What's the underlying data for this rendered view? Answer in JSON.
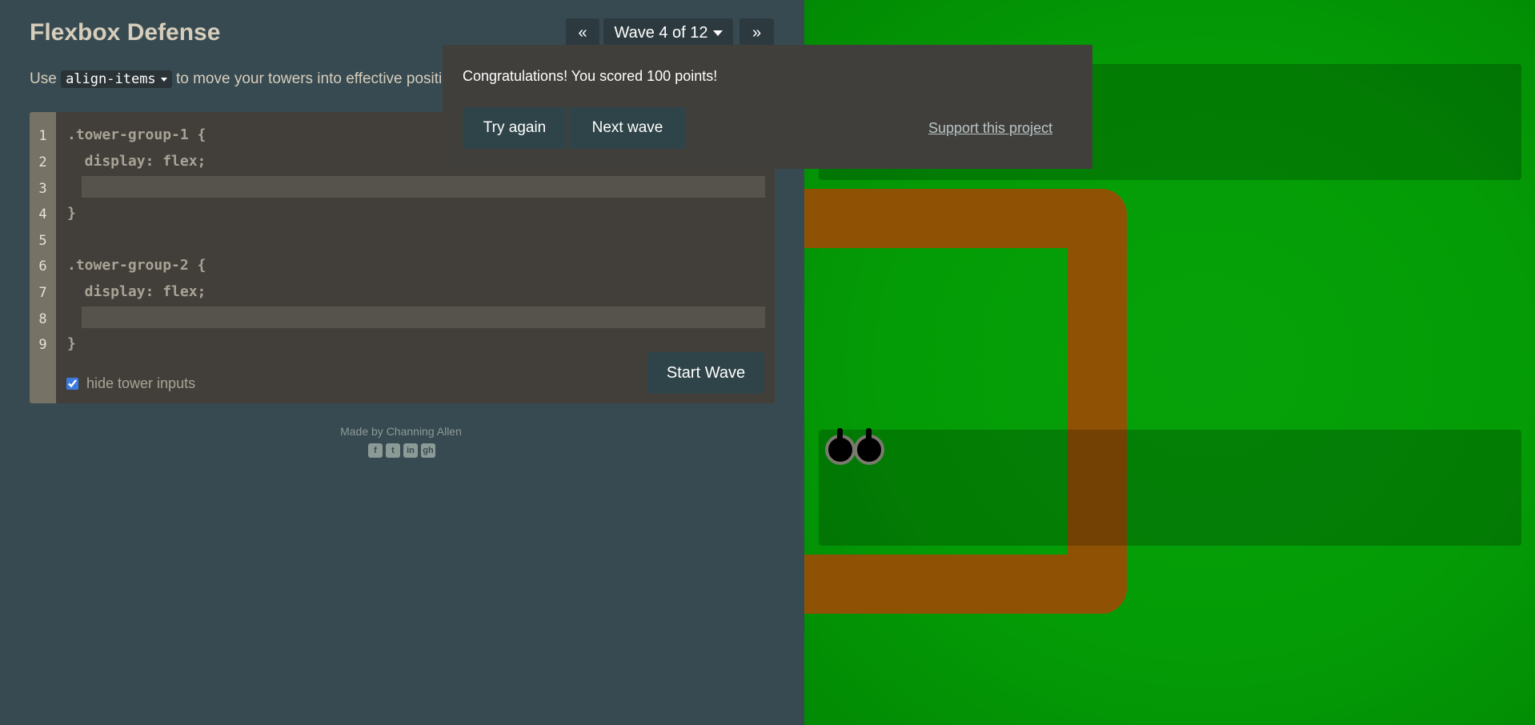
{
  "header": {
    "title": "Flexbox Defense",
    "prev_label": "«",
    "level_label": "Wave 4 of 12",
    "next_label": "»"
  },
  "instructions": {
    "prefix": "Use",
    "property": "align-items",
    "suffix": "to move your towers into effective positi"
  },
  "editor": {
    "line_numbers": [
      "1",
      "2",
      "3",
      "4",
      "5",
      "6",
      "7",
      "8",
      "9"
    ],
    "lines": [
      ".tower-group-1 {",
      "  display: flex;",
      "",
      "}",
      "",
      ".tower-group-2 {",
      "  display: flex;",
      "",
      "}"
    ],
    "input_1_value": "",
    "input_2_value": "",
    "start_label": "Start Wave",
    "hide_label": "hide tower inputs",
    "hide_checked": true
  },
  "credits": {
    "text": "Made by Channing Allen",
    "socials": [
      "facebook-icon",
      "twitter-icon",
      "linkedin-icon",
      "github-icon"
    ],
    "social_glyphs": [
      "f",
      "t",
      "in",
      "gh"
    ]
  },
  "modal": {
    "message": "Congratulations! You scored 100 points!",
    "try_label": "Try again",
    "next_label": "Next wave",
    "support_label": "Support this project"
  },
  "colors": {
    "panel": "#374a51",
    "grass": "#049c06",
    "path": "#8f5204",
    "button": "#2f4449",
    "modal": "#413f3b"
  }
}
